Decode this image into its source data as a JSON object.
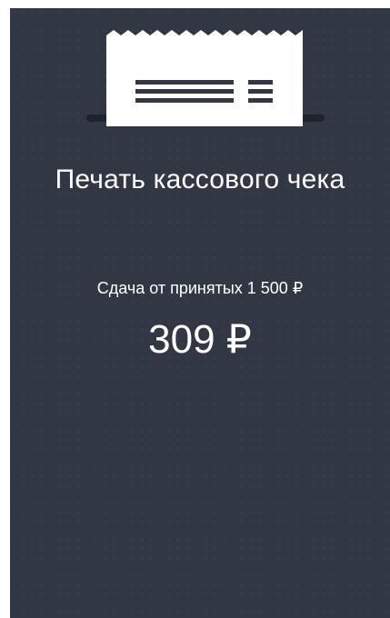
{
  "receipt": {
    "icon": "receipt-printer-icon",
    "title": "Печать кассового чека",
    "change_caption": "Сдача от принятых 1 500 ₽",
    "change_amount": "309 ₽"
  },
  "colors": {
    "background": "#313843",
    "text": "#ffffff",
    "icon": "#ffffff",
    "icon_lines": "#313843",
    "printer_slot": "#1f242c"
  }
}
